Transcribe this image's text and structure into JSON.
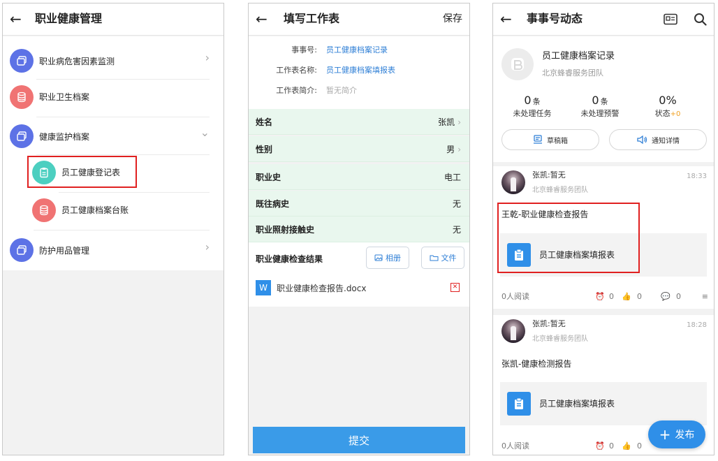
{
  "colors": {
    "accent_blue": "#2f8fe8",
    "link_blue": "#2f7fd6",
    "highlight_red": "#e02020",
    "field_green": "#e9f7ee",
    "orange": "#f0a020"
  },
  "screen1": {
    "back_icon": "back-arrow-icon",
    "title": "职业健康管理",
    "items": [
      {
        "label": "职业病危害因素监测",
        "icon": "stack-icon",
        "color": "blue",
        "chevron": "›"
      },
      {
        "label": "职业卫生档案",
        "icon": "database-icon",
        "color": "red"
      },
      {
        "label": "健康监护档案",
        "icon": "stack-icon",
        "color": "blue",
        "chevron": "⌄"
      },
      {
        "label": "员工健康登记表",
        "icon": "clipboard-icon",
        "color": "teal"
      },
      {
        "label": "员工健康档案台账",
        "icon": "database-icon",
        "color": "red"
      },
      {
        "label": "防护用品管理",
        "icon": "stack-icon",
        "color": "blue",
        "chevron": "›"
      }
    ]
  },
  "screen2": {
    "title": "填写工作表",
    "save_label": "保存",
    "info": {
      "item_no_label": "事事号:",
      "item_no_value": "员工健康档案记录",
      "sheet_name_label": "工作表名称:",
      "sheet_name_value": "员工健康档案填报表",
      "intro_label": "工作表简介:",
      "intro_value": "暂无简介"
    },
    "fields": [
      {
        "label": "姓名",
        "value": "张凯",
        "chevron": "›"
      },
      {
        "label": "性别",
        "value": "男",
        "chevron": "›"
      },
      {
        "label": "职业史",
        "value": "电工"
      },
      {
        "label": "既往病史",
        "value": "无"
      },
      {
        "label": "职业照射接触史",
        "value": "无"
      }
    ],
    "result_label": "职业健康检查结果",
    "album_label": "相册",
    "file_label": "文件",
    "attachment": {
      "badge": "W",
      "name": "职业健康检查报告.docx",
      "delete": "✕"
    },
    "submit_label": "提交"
  },
  "screen3": {
    "title": "事事号动态",
    "header": {
      "name": "员工健康档案记录",
      "team": "北京蜂睿服务团队",
      "stats": [
        {
          "num": "0",
          "unit": "条",
          "label": "未处理任务"
        },
        {
          "num": "0",
          "unit": "条",
          "label": "未处理预警"
        },
        {
          "num": "0%",
          "unit": "",
          "label": "状态",
          "extra": "+0"
        }
      ],
      "drafts_label": "草稿箱",
      "notice_label": "通知详情"
    },
    "posts": [
      {
        "author": "张凯:暂无",
        "team": "北京蜂睿服务团队",
        "time": "18:33",
        "text": "王乾-职业健康检查报告",
        "card": "员工健康档案填报表",
        "reads": "0人阅读",
        "alarm": "0",
        "likes": "0",
        "comments": "0"
      },
      {
        "author": "张凯:暂无",
        "team": "北京蜂睿服务团队",
        "time": "18:28",
        "text": "张凯-健康检测报告",
        "card": "员工健康档案填报表",
        "reads": "0人阅读",
        "alarm": "0",
        "likes": "0"
      }
    ],
    "publish_label": "发布"
  }
}
